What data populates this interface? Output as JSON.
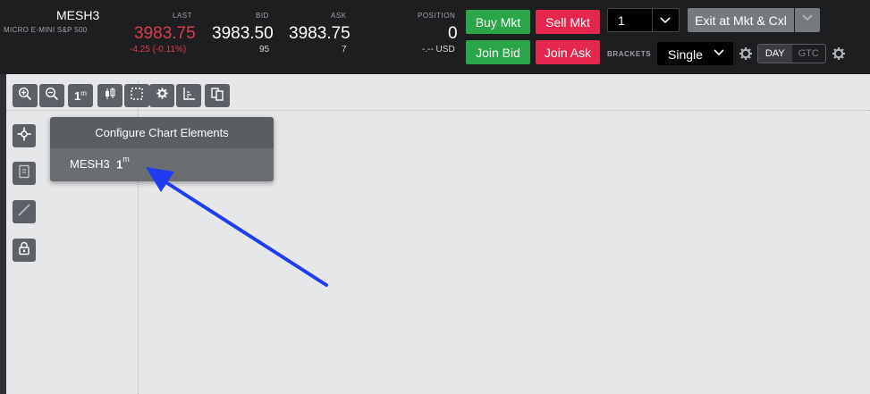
{
  "header": {
    "symbol": "MESH3",
    "description": "MICRO E-MINI S&P 500",
    "last_label": "LAST",
    "last_price": "3983.75",
    "last_change": "-4.25 (-0.11%)",
    "bid_label": "BID",
    "bid_price": "3983.50",
    "bid_size": "95",
    "ask_label": "ASK",
    "ask_price": "3983.75",
    "ask_size": "7",
    "position_label": "POSITION",
    "position_value": "0",
    "position_pnl": "-.-- USD",
    "colors": {
      "up_red": "#e03a4e",
      "buy_green": "#2aa547",
      "sell_pink": "#e5264d"
    }
  },
  "order_buttons": {
    "buy_mkt": "Buy Mkt",
    "sell_mkt": "Sell Mkt",
    "join_bid": "Join Bid",
    "join_ask": "Join Ask"
  },
  "quantity": {
    "value": "1"
  },
  "exit_button": {
    "label": "Exit at Mkt & Cxl"
  },
  "brackets": {
    "label": "BRACKETS",
    "value": "Single"
  },
  "tif": {
    "day": "DAY",
    "gtc": "GTC",
    "selected": "DAY"
  },
  "chart_toolbar": {
    "timeframe_label": "1",
    "timeframe_unit": "m",
    "icons": [
      "zoom-in-icon",
      "zoom-out-icon",
      "timeframe-icon",
      "candlestick-icon",
      "selection-icon",
      "settings-icon",
      "axis-icon",
      "copy-icon"
    ]
  },
  "side_toolbar": {
    "icons": [
      "crosshair-icon",
      "note-icon",
      "line-draw-icon",
      "lock-icon"
    ]
  },
  "configure_menu": {
    "title": "Configure Chart Elements",
    "items": [
      {
        "symbol": "MESH3",
        "timeframe": "1",
        "unit": "m"
      }
    ]
  },
  "annotation": {
    "arrow_color": "#1f3cf2"
  }
}
